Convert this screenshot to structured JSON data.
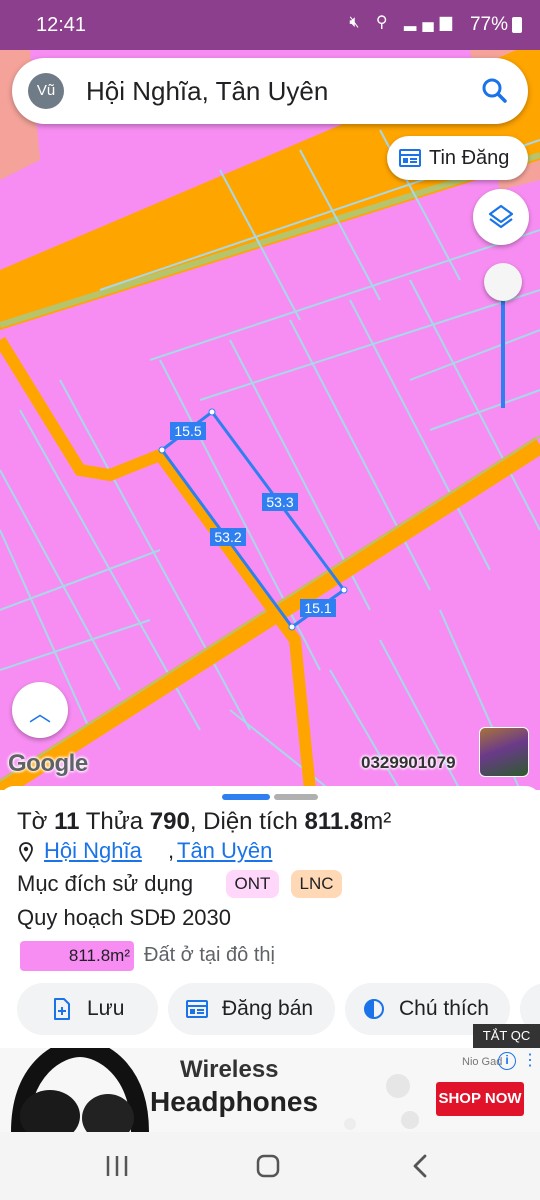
{
  "status_bar": {
    "time": "12:41",
    "battery": "77%",
    "icons": [
      "mute-icon",
      "location-icon",
      "volte-icon",
      "4g-icon",
      "signal-icon",
      "signal-icon",
      "battery-icon"
    ]
  },
  "search": {
    "avatar": "Vũ",
    "query": "Hội Nghĩa, Tân Uyên"
  },
  "map": {
    "tin_dang_label": "Tin Đăng",
    "google_logo": "Google",
    "phone_overlay": "0329901079",
    "edge_labels": [
      "15.5",
      "53.3",
      "53.2",
      "15.1"
    ],
    "colors": {
      "residential": "#f78df2",
      "road": "#ffa500",
      "parcel_line": "#a8d8e8",
      "selection": "#2f7ff0"
    }
  },
  "sheet": {
    "title_prefix": "Tờ",
    "sheet_no": "11",
    "plot_label": "Thửa",
    "plot_no": "790",
    "area_label": ", Diện tích",
    "area_value": "811.8",
    "area_unit": "m²",
    "location": {
      "commune": "Hội Nghĩa",
      "separator": ",",
      "district": "Tân Uyên"
    },
    "purpose_label": "Mục đích sử dụng",
    "purpose_badges": [
      "ONT",
      "LNC"
    ],
    "planning_label": "Quy hoạch SDĐ 2030",
    "planning_area": "811.8m²",
    "planning_desc": "Đất ở tại đô thị",
    "actions": {
      "save": "Lưu",
      "post_sale": "Đăng bán",
      "legend": "Chú thích"
    }
  },
  "ad": {
    "close_label": "TẮT QC",
    "line1": "Wireless",
    "line2": "Headphones",
    "brand": "Nio Gad",
    "cta": "SHOP NOW"
  }
}
